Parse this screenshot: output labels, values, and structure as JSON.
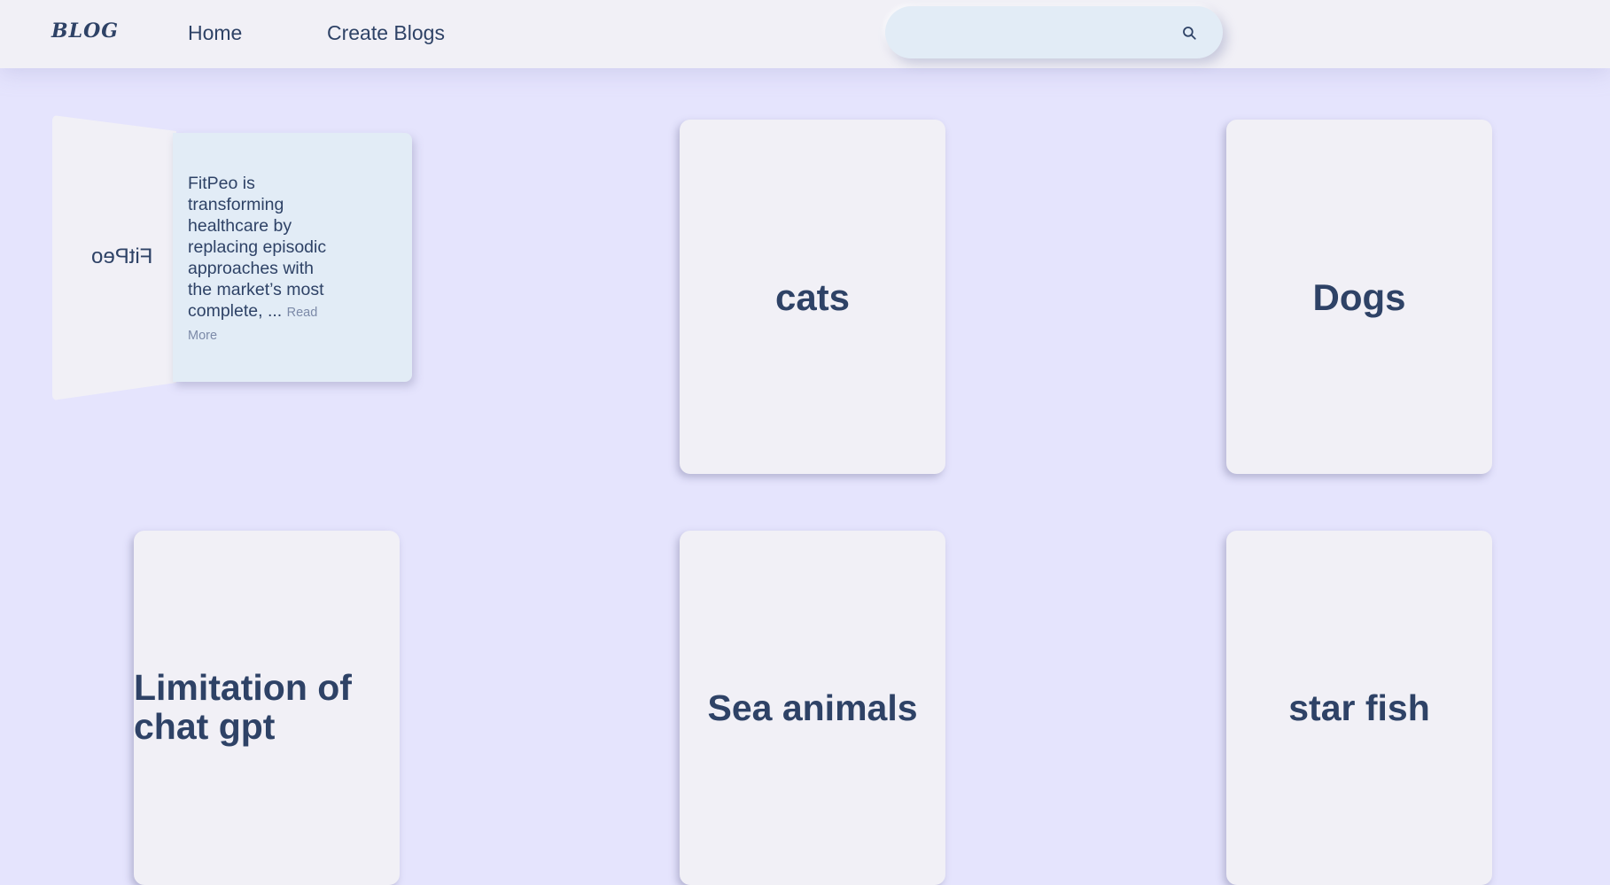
{
  "nav": {
    "logo": "BLOG",
    "links": [
      {
        "label": "Home"
      },
      {
        "label": "Create Blogs"
      }
    ],
    "search": {
      "placeholder": "",
      "value": "",
      "icon": "search-icon"
    }
  },
  "open_card": {
    "cover_title": "FitPeo",
    "text": "FitPeo is transforming healthcare by replacing episodic approaches with the market’s most complete, ...",
    "read_more": "Read More"
  },
  "cards": [
    {
      "title": "cats"
    },
    {
      "title": "Dogs"
    },
    {
      "title": "Limitation of chat gpt"
    },
    {
      "title": "Sea animals"
    },
    {
      "title": "star fish"
    }
  ],
  "colors": {
    "background": "#e5e4fd",
    "nav_background": "#f1f0f6",
    "card_background": "#f1f0f6",
    "search_background": "#e2ecf6",
    "text": "#2e4266"
  }
}
